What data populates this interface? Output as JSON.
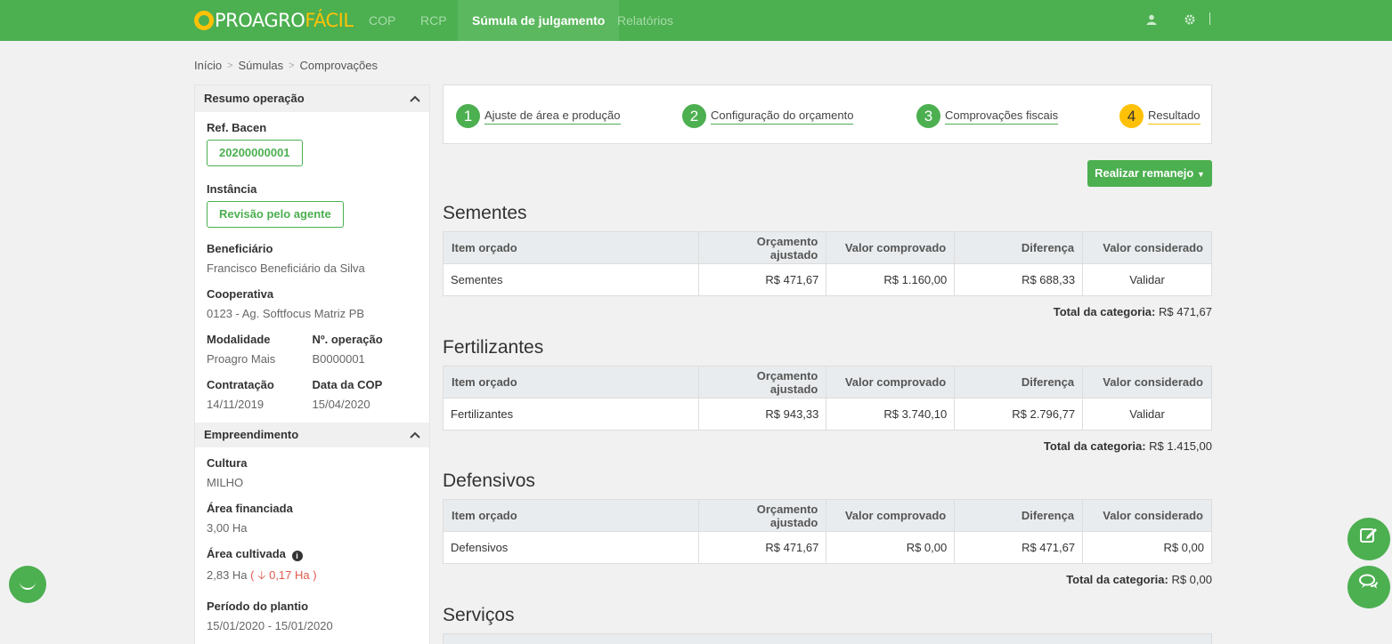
{
  "nav": {
    "logo_main": "PROAGRO",
    "logo_accent": "FÁCIL",
    "links": [
      "COP",
      "RCP",
      "Súmula de julgamento",
      "Relatórios"
    ],
    "user_icon": "user-icon",
    "settings_icon": "gear-icon"
  },
  "breadcrumb": [
    "Início",
    "Súmulas",
    "Comprovações"
  ],
  "resumo": {
    "title": "Resumo operação",
    "ref_bacen_label": "Ref. Bacen",
    "ref_bacen_value": "20200000001",
    "instancia_label": "Instância",
    "instancia_value": "Revisão pelo agente",
    "beneficiario_label": "Beneficiário",
    "beneficiario_value": "Francisco Beneficiário da Silva",
    "cooperativa_label": "Cooperativa",
    "cooperativa_value": "0123 - Ag. Softfocus Matriz PB",
    "modalidade_label": "Modalidade",
    "modalidade_value": "Proagro Mais",
    "operacao_label": "Nº. operação",
    "operacao_value": "B0000001",
    "contratacao_label": "Contratação",
    "contratacao_value": "14/11/2019",
    "data_cop_label": "Data da COP",
    "data_cop_value": "15/04/2020"
  },
  "empreendimento": {
    "title": "Empreendimento",
    "cultura_label": "Cultura",
    "cultura_value": "MILHO",
    "area_fin_label": "Área financiada",
    "area_fin_value": "3,00 Ha",
    "area_cult_label": "Área cultivada",
    "area_cult_value": "2,83 Ha",
    "area_cult_diff": "0,17 Ha",
    "periodo_label": "Período do plantio",
    "periodo_value": "15/01/2020 - 15/01/2020"
  },
  "steps": [
    {
      "num": "1",
      "label": "Ajuste de área e produção"
    },
    {
      "num": "2",
      "label": "Configuração do orçamento"
    },
    {
      "num": "3",
      "label": "Comprovações fiscais"
    },
    {
      "num": "4",
      "label": "Resultado"
    }
  ],
  "action_button": "Realizar remanejo",
  "table_headers": [
    "Item orçado",
    "Orçamento ajustado",
    "Valor comprovado",
    "Diferença",
    "Valor considerado"
  ],
  "total_label": "Total da categoria:",
  "categories": [
    {
      "title": "Sementes",
      "item": "Sementes",
      "orcamento": "R$ 471,67",
      "comprovado": "R$ 1.160,00",
      "diferenca": "R$ 688,33",
      "considerado": "Validar",
      "total": "R$ 471,67"
    },
    {
      "title": "Fertilizantes",
      "item": "Fertilizantes",
      "orcamento": "R$ 943,33",
      "comprovado": "R$ 3.740,10",
      "diferenca": "R$ 2.796,77",
      "considerado": "Validar",
      "total": "R$ 1.415,00"
    },
    {
      "title": "Defensivos",
      "item": "Defensivos",
      "orcamento": "R$ 471,67",
      "comprovado": "R$ 0,00",
      "diferenca": "R$ 471,67",
      "considerado": "R$ 0,00",
      "total": "R$ 0,00"
    },
    {
      "title": "Serviços"
    }
  ],
  "colors": {
    "brand": "#4caf50",
    "accent": "#ffc107",
    "negative": "#e05a4f",
    "link": "#4a7bbf"
  }
}
